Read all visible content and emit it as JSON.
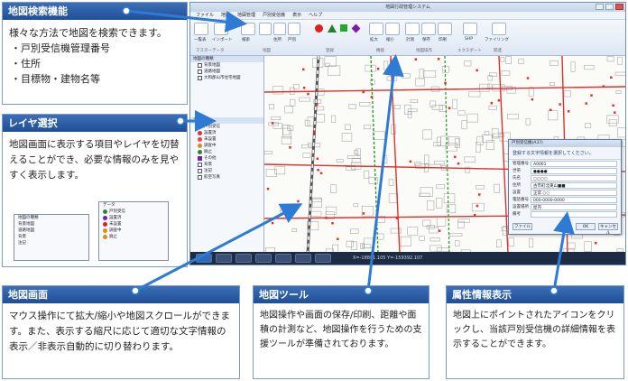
{
  "panels": {
    "search": {
      "title": "地図検索機能",
      "lines": [
        "様々な方法で地図を検索できます。",
        "・戸別受信機管理番号",
        "・住所",
        "・目標物・建物名等"
      ]
    },
    "layer": {
      "title": "レイヤ選択",
      "text": "地図画面に表示する項目やレイヤを切替えることができ、必要な情報のみを見やすく表示します。"
    },
    "map_screen": {
      "title": "地図画面",
      "text": "マウス操作にて拡大/縮小や地図スクロールができます。また、表示する縮尺に応じて適切な文字情報の表示／非表示自動的に切り替わります。"
    },
    "map_tools": {
      "title": "地図ツール",
      "text": "地図操作や画面の保存/印刷、距離や面積の計測など、地図操作を行うための支援ツールが準備されております。"
    },
    "attributes": {
      "title": "属性情報表示",
      "text": "地図上にポイントされたアイコンをクリックし、当該戸別受信機の詳細情報を表示することができます。"
    }
  },
  "app": {
    "window_title": "地図行政管理システム",
    "menus": [
      "ファイル",
      "地図",
      "地図管理",
      "戸別受信機",
      "表示",
      "ヘルプ"
    ],
    "ribbon": {
      "buttons": [
        "一覧表",
        "インポート",
        "検索",
        "地図ツール",
        "住所",
        "戸別",
        "番号",
        "名前",
        "全て",
        "拡大",
        "縮小",
        "計測",
        "保存",
        "印刷",
        "SHP",
        "ファイリング"
      ],
      "groups": [
        "マスターデータ",
        "地図",
        "登録",
        "機能",
        "地図操作",
        "エクスポート",
        "関連"
      ]
    },
    "sidebar": {
      "section1": "地図の種類",
      "section1_items": [
        "背景地図",
        "道路地図",
        "大和郡山市住宅地図"
      ],
      "section2": "データ",
      "section2_items": [
        "戸別受信",
        "設置済",
        "未設置",
        "調査中",
        "廃止",
        "その他",
        "背景",
        "注記",
        "航空写真"
      ]
    },
    "status": "X=-18881.105 Y=-159392.107",
    "dialog": {
      "title": "戸別受信機(A37)",
      "heading": "登録する文字情報を選択してください。",
      "fields": [
        {
          "k": "管理番号",
          "v": "A0001"
        },
        {
          "k": "世帯",
          "v": "●●●●"
        },
        {
          "k": "氏名",
          "v": "○○○○"
        },
        {
          "k": "住所",
          "v": "古市町北東山■■"
        },
        {
          "k": "設置",
          "v": "正常 ○○"
        },
        {
          "k": "電話番号",
          "v": "000-0000-0000"
        },
        {
          "k": "設置場所",
          "v": "屋内"
        },
        {
          "k": "備考",
          "v": ""
        }
      ],
      "buttons": [
        "ファイル",
        "OK",
        "キャンセル"
      ]
    }
  },
  "colors": {
    "panel_header": "#2a5ca8",
    "arrow": "#2e7bd6",
    "road_red": "#e03030",
    "road_green": "#2a9a2a"
  }
}
